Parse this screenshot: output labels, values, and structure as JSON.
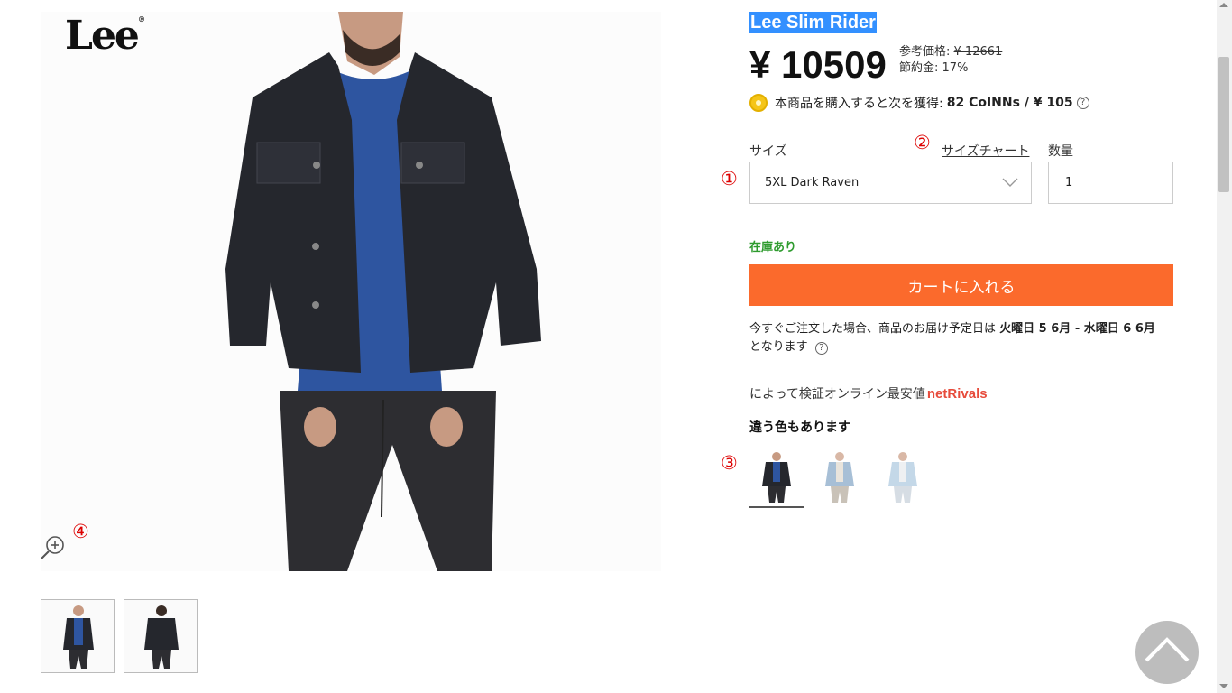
{
  "brand": {
    "logo_text": "Lee"
  },
  "product": {
    "title": "Lee Slim Rider",
    "price": "¥ 10509",
    "reference_label": "参考価格:",
    "reference_price": "¥ 12661",
    "savings_label": "節約金:",
    "savings_value": "17%"
  },
  "coins": {
    "icon": "coin-icon",
    "text": "本商品を購入すると次を獲得:",
    "amount": "82 CoINNs / ¥ 105",
    "help": "?"
  },
  "size": {
    "label": "サイズ",
    "chart_link": "サイズチャート",
    "selected": "5XL Dark Raven"
  },
  "quantity": {
    "label": "数量",
    "value": "1"
  },
  "stock": "在庫あり",
  "cart_button": "カートに入れる",
  "delivery": {
    "prefix": "今すぐご注文した場合、商品のお届け予定日は",
    "range": "火曜日 5 6月 - 水曜日 6 6月",
    "suffix": "となります",
    "help": "?"
  },
  "rivals": {
    "text": "によって検証オンライン最安値",
    "brand": "netRivals"
  },
  "colors": {
    "title": "違う色もあります",
    "swatches": [
      "dark-raven",
      "light-blue",
      "pale-blue"
    ]
  },
  "markers": [
    "①",
    "②",
    "③",
    "④"
  ],
  "colors_hex": {
    "accent_orange": "#fb6a2c",
    "stock_green": "#2e9b2e",
    "highlight_blue": "#3390ff",
    "rivals_red": "#e74c3c"
  }
}
